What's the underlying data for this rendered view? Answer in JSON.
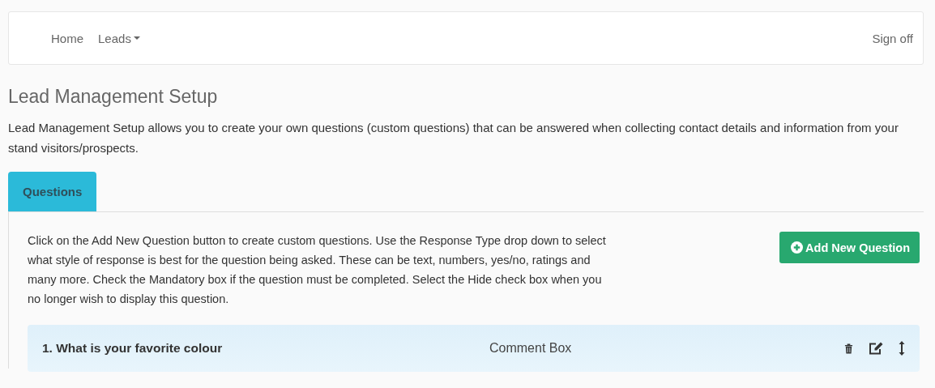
{
  "navbar": {
    "links": [
      {
        "label": "Home",
        "kind": "link"
      },
      {
        "label": "Leads",
        "kind": "dropdown"
      }
    ],
    "sign_off": "Sign off"
  },
  "page": {
    "title": "Lead Management Setup",
    "description": "Lead Management Setup allows you to create your own questions (custom questions) that can be answered when collecting contact details and information from your stand visitors/prospects."
  },
  "tabs": [
    {
      "label": "Questions",
      "selected": true
    }
  ],
  "panel": {
    "instructions": "Click on the Add New Question button to create custom questions. Use the Response Type drop down to select what style of response is best for the question being asked. These can be text, numbers, yes/no, ratings and many more. Check the Mandatory box if the question must be completed. Select the Hide check box when you no longer wish to display this question.",
    "add_button": "Add New Question",
    "questions": [
      {
        "title": "1. What is your favorite colour",
        "response_type": "Comment Box"
      }
    ]
  }
}
